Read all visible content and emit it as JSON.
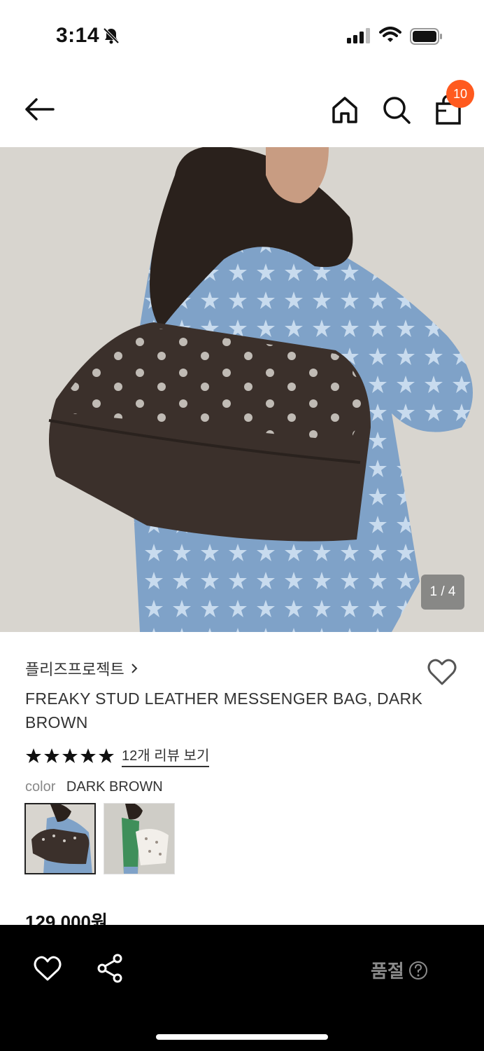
{
  "status": {
    "time": "3:14"
  },
  "nav": {
    "cart_count": "10"
  },
  "gallery": {
    "indicator": "1 / 4"
  },
  "product": {
    "brand": "플리즈프로젝트",
    "name": "FREAKY STUD LEATHER MESSENGER BAG, DARK BROWN",
    "rating": 5,
    "review_link": "12개 리뷰 보기",
    "color_label": "color",
    "color_value": "DARK BROWN",
    "price": "129,000원"
  },
  "bottom_bar": {
    "soldout_label": "품절"
  },
  "icons": {
    "back": "arrow-left-icon",
    "home": "home-icon",
    "search": "search-icon",
    "cart": "shopping-bag-icon",
    "wish": "heart-icon",
    "share": "share-icon",
    "help": "question-circle-icon"
  },
  "colors": {
    "badge": "#ff5a1f",
    "bottom_bar": "#000000",
    "soldout_text": "#8a8a8a"
  }
}
